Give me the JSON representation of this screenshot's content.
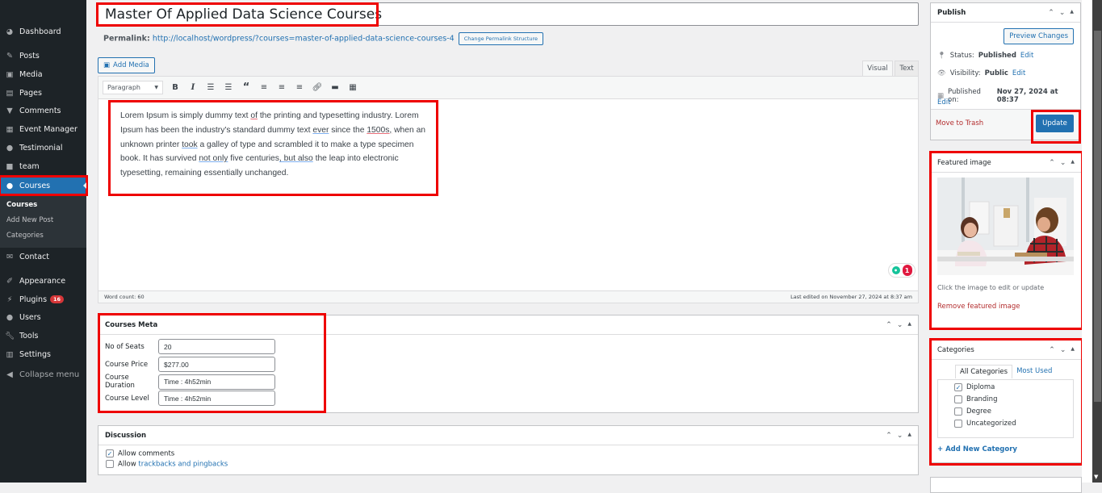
{
  "sidebar": {
    "items": [
      {
        "label": "Dashboard",
        "icon": "dashboard-icon"
      },
      {
        "label": "Posts",
        "icon": "pin-icon"
      },
      {
        "label": "Media",
        "icon": "media-icon"
      },
      {
        "label": "Pages",
        "icon": "pages-icon"
      },
      {
        "label": "Comments",
        "icon": "comment-icon"
      },
      {
        "label": "Event Manager",
        "icon": "calendar-icon"
      },
      {
        "label": "Testimonial",
        "icon": "person-icon"
      },
      {
        "label": "team",
        "icon": "video-icon"
      },
      {
        "label": "Courses",
        "icon": "person-icon"
      },
      {
        "label": "Contact",
        "icon": "mail-icon"
      },
      {
        "label": "Appearance",
        "icon": "brush-icon"
      },
      {
        "label": "Plugins",
        "icon": "plug-icon",
        "badge": "16"
      },
      {
        "label": "Users",
        "icon": "user-icon"
      },
      {
        "label": "Tools",
        "icon": "wrench-icon"
      },
      {
        "label": "Settings",
        "icon": "settings-icon"
      }
    ],
    "submenu": [
      "Courses",
      "Add New Post",
      "Categories"
    ],
    "collapse_label": "Collapse menu"
  },
  "editor": {
    "title": "Master Of Applied Data Science Courses",
    "permalink_label": "Permalink:",
    "permalink_url": "http://localhost/wordpress/?courses=master-of-applied-data-science-courses-4",
    "change_permalink_label": "Change Permalink Structure",
    "add_media_label": "Add Media",
    "tab_visual": "Visual",
    "tab_text": "Text",
    "format_select": "Paragraph",
    "content_parts": [
      {
        "t": "Lorem Ipsum is simply dummy text ",
        "u": ""
      },
      {
        "t": "of",
        "u": "red"
      },
      {
        "t": " the printing and typesetting industry. Lorem Ipsum has been the industry's standard dummy text ",
        "u": ""
      },
      {
        "t": "ever",
        "u": "blue"
      },
      {
        "t": " since the ",
        "u": ""
      },
      {
        "t": "1500s,",
        "u": "red"
      },
      {
        "t": " when an unknown printer ",
        "u": ""
      },
      {
        "t": "took",
        "u": "blue"
      },
      {
        "t": " a galley of type and scrambled it to make a type specimen book. It has survived ",
        "u": ""
      },
      {
        "t": "not only",
        "u": "blue"
      },
      {
        "t": " five centuries",
        "u": ""
      },
      {
        "t": ", but also",
        "u": "blue"
      },
      {
        "t": " the leap into electronic typesetting, remaining essentially unchanged.",
        "u": ""
      }
    ],
    "word_count": "Word count: 60",
    "last_edited": "Last edited on November 27, 2024 at 8:37 am",
    "grammarly_count": "1"
  },
  "courses_meta": {
    "title": "Courses Meta",
    "fields": [
      {
        "label": "No of Seats",
        "value": "20"
      },
      {
        "label": "Course Price",
        "value": "$277.00"
      },
      {
        "label": "Course Duration",
        "value": "Time : 4h52min"
      },
      {
        "label": "Course Level",
        "value": "Time : 4h52min"
      }
    ]
  },
  "discussion": {
    "title": "Discussion",
    "allow_comments": "Allow comments",
    "allow_comments_checked": true,
    "allow_prefix": "Allow",
    "trackbacks_link": "trackbacks and pingbacks",
    "trackbacks_checked": false
  },
  "publish": {
    "title": "Publish",
    "preview_label": "Preview Changes",
    "status_label": "Status:",
    "status_value": "Published",
    "visibility_label": "Visibility:",
    "visibility_value": "Public",
    "published_on_label": "Published on:",
    "published_on_value": "Nov 27, 2024 at 08:37",
    "edit_label": "Edit",
    "trash_label": "Move to Trash",
    "update_label": "Update"
  },
  "featured_image": {
    "title": "Featured image",
    "hint": "Click the image to edit or update",
    "remove_label": "Remove featured image"
  },
  "categories": {
    "title": "Categories",
    "tab_all": "All Categories",
    "tab_most_used": "Most Used",
    "items": [
      {
        "label": "Diploma",
        "checked": true
      },
      {
        "label": "Branding",
        "checked": false
      },
      {
        "label": "Degree",
        "checked": false
      },
      {
        "label": "Uncategorized",
        "checked": false
      }
    ],
    "add_new_label": "+ Add New Category"
  }
}
